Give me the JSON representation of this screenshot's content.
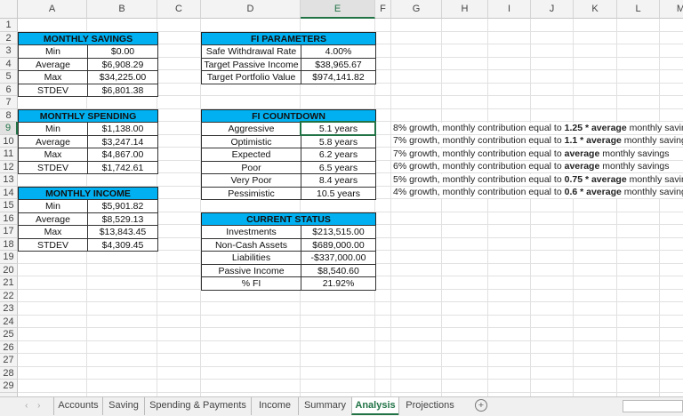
{
  "columns": [
    "A",
    "B",
    "C",
    "D",
    "E",
    "F",
    "G",
    "H",
    "I",
    "J",
    "K",
    "L",
    "M"
  ],
  "rows_visible": 29,
  "selected_cell": "E9",
  "accent": "#00b0f0",
  "tables": {
    "monthly_savings": {
      "title": "MONTHLY SAVINGS",
      "rows": [
        [
          "Min",
          "$0.00"
        ],
        [
          "Average",
          "$6,908.29"
        ],
        [
          "Max",
          "$34,225.00"
        ],
        [
          "STDEV",
          "$6,801.38"
        ]
      ]
    },
    "monthly_spending": {
      "title": "MONTHLY SPENDING",
      "rows": [
        [
          "Min",
          "$1,138.00"
        ],
        [
          "Average",
          "$3,247.14"
        ],
        [
          "Max",
          "$4,867.00"
        ],
        [
          "STDEV",
          "$1,742.61"
        ]
      ]
    },
    "monthly_income": {
      "title": "MONTHLY INCOME",
      "rows": [
        [
          "Min",
          "$5,901.82"
        ],
        [
          "Average",
          "$8,529.13"
        ],
        [
          "Max",
          "$13,843.45"
        ],
        [
          "STDEV",
          "$4,309.45"
        ]
      ]
    },
    "fi_parameters": {
      "title": "FI PARAMETERS",
      "rows": [
        [
          "Safe Withdrawal Rate",
          "4.00%"
        ],
        [
          "Target Passive Income",
          "$38,965.67"
        ],
        [
          "Target Portfolio Value",
          "$974,141.82"
        ]
      ]
    },
    "fi_countdown": {
      "title": "FI COUNTDOWN",
      "rows": [
        [
          "Aggressive",
          "5.1 years"
        ],
        [
          "Optimistic",
          "5.8 years"
        ],
        [
          "Expected",
          "6.2 years"
        ],
        [
          "Poor",
          "6.5 years"
        ],
        [
          "Very Poor",
          "8.4 years"
        ],
        [
          "Pessimistic",
          "10.5 years"
        ]
      ]
    },
    "current_status": {
      "title": "CURRENT STATUS",
      "rows": [
        [
          "Investments",
          "$213,515.00"
        ],
        [
          "Non-Cash Assets",
          "$689,000.00"
        ],
        [
          "Liabilities",
          "-$337,000.00"
        ],
        [
          "Passive Income",
          "$8,540.60"
        ],
        [
          "% FI",
          "21.92%"
        ]
      ]
    }
  },
  "notes": [
    [
      {
        "t": "8% growth, monthly contribution equal to ",
        "b": false
      },
      {
        "t": "1.25 * average",
        "b": true
      },
      {
        "t": " monthly savings",
        "b": false
      }
    ],
    [
      {
        "t": "7% growth, monthly contribution equal to ",
        "b": false
      },
      {
        "t": "1.1 * average",
        "b": true
      },
      {
        "t": " monthly savings",
        "b": false
      }
    ],
    [
      {
        "t": "7% growth, monthly contribution equal to ",
        "b": false
      },
      {
        "t": "average",
        "b": true
      },
      {
        "t": " monthly savings",
        "b": false
      }
    ],
    [
      {
        "t": "6% growth, monthly contribution equal to ",
        "b": false
      },
      {
        "t": "average",
        "b": true
      },
      {
        "t": " monthly savings",
        "b": false
      }
    ],
    [
      {
        "t": "5% growth, monthly contribution equal to ",
        "b": false
      },
      {
        "t": "0.75 * average",
        "b": true
      },
      {
        "t": " monthly savings",
        "b": false
      }
    ],
    [
      {
        "t": "4% growth, monthly contribution equal to ",
        "b": false
      },
      {
        "t": "0.6 * average",
        "b": true
      },
      {
        "t": " monthly savings",
        "b": false
      }
    ]
  ],
  "sheet_tabs": [
    "Accounts",
    "Saving",
    "Spending & Payments",
    "Income",
    "Summary",
    "Analysis",
    "Projections"
  ],
  "active_tab": "Analysis",
  "add_sheet": "+"
}
